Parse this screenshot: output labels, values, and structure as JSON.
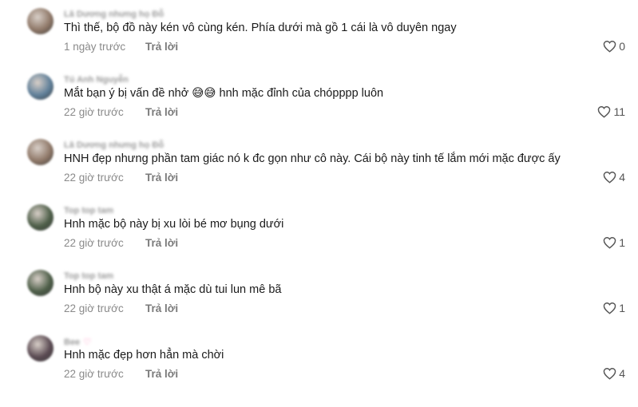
{
  "comments": [
    {
      "username": "Lâ Dương nhưng họ Đỗ",
      "text": "Thì thế, bộ đồ này kén vô cùng kén. Phía dưới mà gồ 1 cái là vô duyên ngay",
      "time": "1 ngày trước",
      "reply": "Trả lời",
      "likes": "0",
      "avatar_color": "#8f7868"
    },
    {
      "username": "Tú Anh Nguyễn",
      "text": "Mắt bạn ý bị vấn đề nhở 😅😅 hnh mặc đỉnh của chópppp luôn",
      "time": "22 giờ trước",
      "reply": "Trả lời",
      "likes": "11",
      "avatar_color": "#5f7f99"
    },
    {
      "username": "Lâ Dương nhưng họ Đỗ",
      "text": "HNH đẹp nhưng phần tam giác nó k đc gọn như cô này. Cái bộ này tinh tế lắm mới mặc được ấy",
      "time": "22 giờ trước",
      "reply": "Trả lời",
      "likes": "4",
      "avatar_color": "#8f7868"
    },
    {
      "username": "Top top tam",
      "text": "Hnh mặc bộ này bị xu lòi bé mơ bụng dưới",
      "time": "22 giờ trước",
      "reply": "Trả lời",
      "likes": "1",
      "avatar_color": "#4d5e48"
    },
    {
      "username": "Top top tam",
      "text": "Hnh bộ này xu thật á mặc dù tui lun mê bã",
      "time": "22 giờ trước",
      "reply": "Trả lời",
      "likes": "1",
      "avatar_color": "#4d5e48"
    },
    {
      "username": "Bee",
      "text": "Hnh mặc đẹp hơn hẳn mà chời",
      "time": "22 giờ trước",
      "reply": "Trả lời",
      "likes": "4",
      "avatar_color": "#5a4a52"
    }
  ],
  "username_heart": "♡",
  "icons": {
    "like": "heart-outline-icon"
  }
}
